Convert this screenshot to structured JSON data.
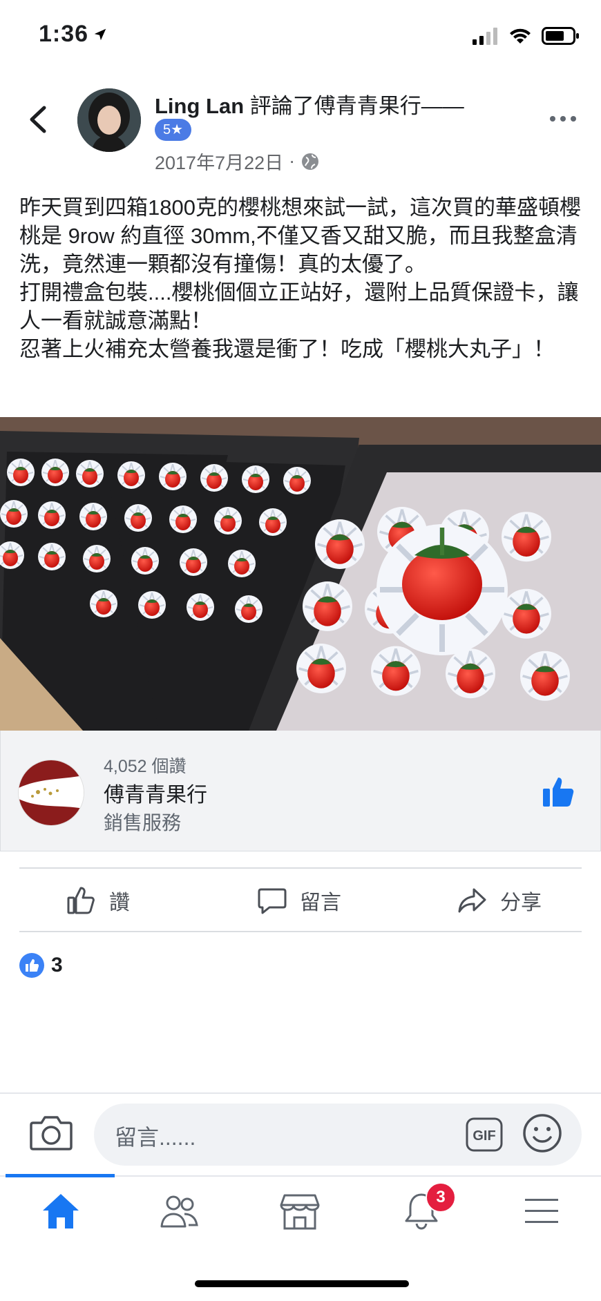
{
  "status_bar": {
    "time": "1:36",
    "location_icon": "location-arrow-icon",
    "signal_icon": "signal-icon",
    "wifi_icon": "wifi-icon",
    "battery_icon": "battery-icon"
  },
  "header": {
    "back_icon": "chevron-left-icon",
    "author_name": "Ling Lan",
    "action_text": "評論了傅青青果行——",
    "rank_badge": "5★",
    "date": "2017年7月22日",
    "separator": "·",
    "privacy_icon": "globe-icon",
    "more_icon": "more-dots-icon"
  },
  "post": {
    "text": "昨天買到四箱1800克的櫻桃想來試一試，這次買的華盛頓櫻桃是 9row 約直徑 30mm,不僅又香又甜又脆，而且我整盒清洗，竟然連一顆都沒有撞傷！真的太優了。\n打開禮盒包裝....櫻桃個個立正站好，還附上品質保證卡，讓人一看就誠意滿點！\n忍著上火補充太營養我還是衝了！吃成「櫻桃大丸子」！",
    "photo_icon": "strawberry-photo"
  },
  "page_card": {
    "likes": "4,052 個讚",
    "name": "傅青青果行",
    "category": "銷售服務",
    "like_icon": "thumbs-up-icon"
  },
  "actions": {
    "like": "讚",
    "comment": "留言",
    "share": "分享"
  },
  "reactions": {
    "count": "3"
  },
  "composer": {
    "placeholder": "留言......",
    "gif_label": "GIF"
  },
  "tab_bar": {
    "notification_count": "3"
  },
  "colors": {
    "accent": "#1877f2",
    "badge": "#e41e3f",
    "rank": "#4b7be5"
  }
}
